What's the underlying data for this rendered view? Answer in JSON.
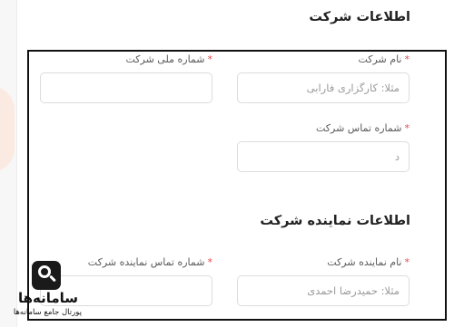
{
  "sections": {
    "company": {
      "title": "اطلاعات شرکت",
      "fields": {
        "company_name": {
          "label": "نام شرکت",
          "required_mark": "*",
          "value": "",
          "placeholder": "مثلا: کارگزاری فارابی"
        },
        "national_id": {
          "label": "شماره ملی شرکت",
          "required_mark": "*",
          "value": "",
          "placeholder": ""
        },
        "company_phone": {
          "label": "شماره تماس شرکت",
          "required_mark": "*",
          "value": "",
          "placeholder": "د"
        }
      }
    },
    "representative": {
      "title": "اطلاعات نماینده شرکت",
      "fields": {
        "rep_name": {
          "label": "نام نماینده شرکت",
          "required_mark": "*",
          "value": "",
          "placeholder": "مثلا: حمیدرضا احمدی"
        },
        "rep_phone": {
          "label": "شماره تماس نماینده شرکت",
          "required_mark": "*",
          "value": "",
          "placeholder": ""
        }
      }
    }
  },
  "logo": {
    "name": "سامانه‌ها",
    "tagline": "پورتال جامع سامانه‌ها",
    "icon": "magnifier-monitor-icon"
  }
}
